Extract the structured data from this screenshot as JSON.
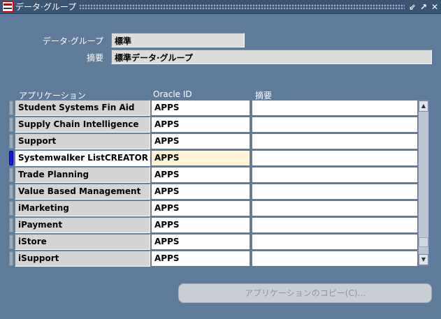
{
  "window": {
    "title": "データ·グループ",
    "controls": [
      "⇙",
      "↗",
      "✕"
    ]
  },
  "header": {
    "data_group_label": "データ·グループ",
    "data_group_value": "標準",
    "description_label": "摘要",
    "description_value": "標準データ·グループ"
  },
  "table": {
    "columns": [
      "アプリケーション",
      "Oracle ID",
      "摘要"
    ],
    "rows": [
      {
        "application": "Student Systems Fin Aid",
        "oracle_id": "APPS",
        "description": ""
      },
      {
        "application": "Supply Chain Intelligence",
        "oracle_id": "APPS",
        "description": ""
      },
      {
        "application": "Support",
        "oracle_id": "APPS",
        "description": ""
      },
      {
        "application": "Systemwalker ListCREATOR",
        "oracle_id": "APPS",
        "description": ""
      },
      {
        "application": "Trade Planning",
        "oracle_id": "APPS",
        "description": ""
      },
      {
        "application": "Value Based Management",
        "oracle_id": "APPS",
        "description": ""
      },
      {
        "application": "iMarketing",
        "oracle_id": "APPS",
        "description": ""
      },
      {
        "application": "iPayment",
        "oracle_id": "APPS",
        "description": ""
      },
      {
        "application": "iStore",
        "oracle_id": "APPS",
        "description": ""
      },
      {
        "application": "iSupport",
        "oracle_id": "APPS",
        "description": ""
      }
    ],
    "active_row": 3
  },
  "buttons": {
    "copy_applications": "アプリケーションのコピー(C)..."
  },
  "colors": {
    "background": "#5f7b9c",
    "titlebar": "#3a5474",
    "active_indicator": "#1a1ad6",
    "active_cell": "#fff5d6"
  }
}
